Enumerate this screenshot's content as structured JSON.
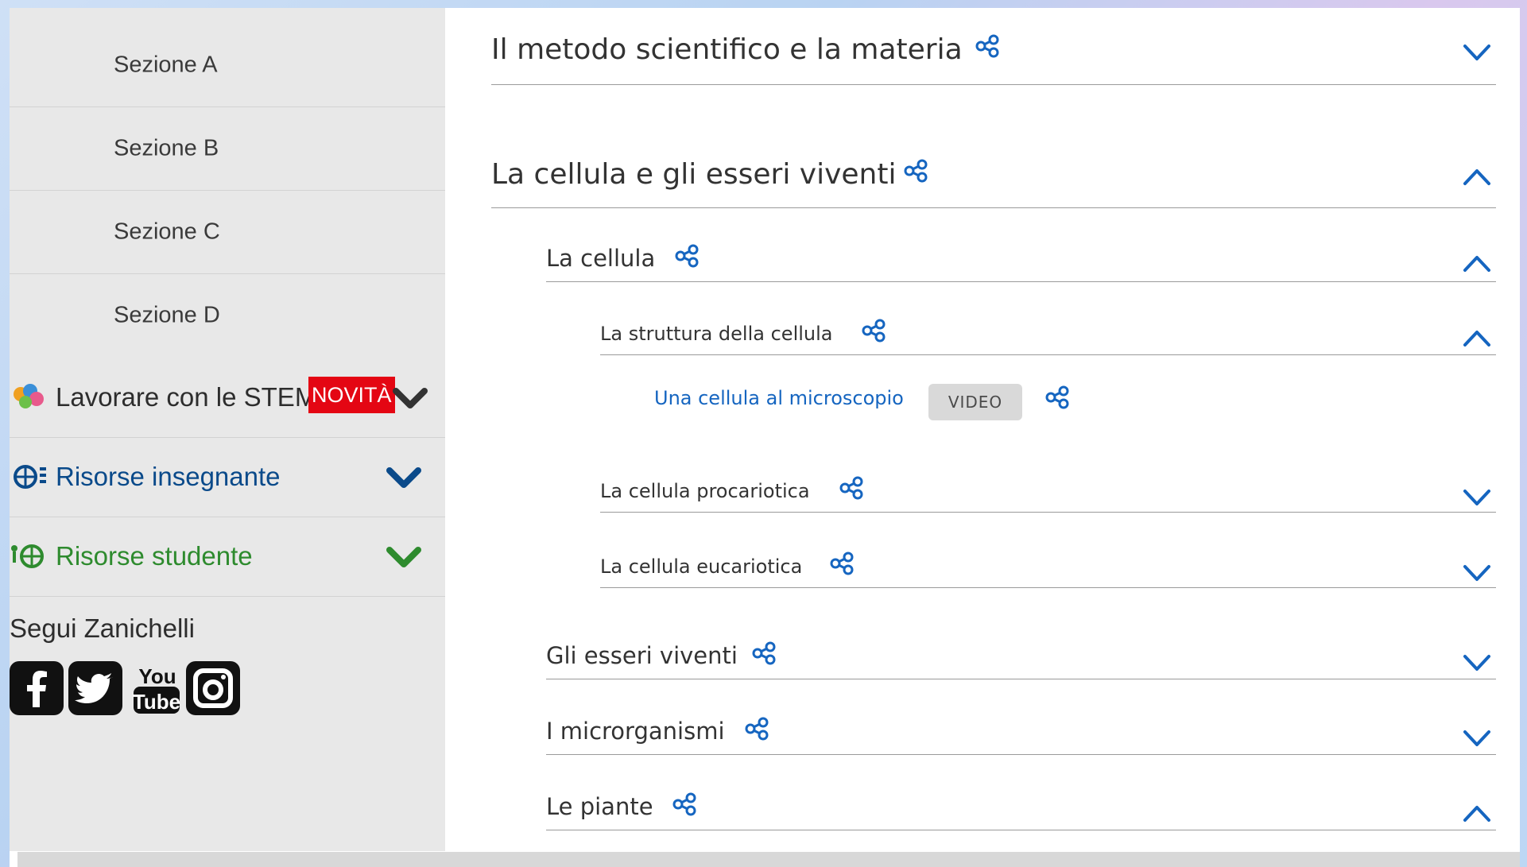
{
  "sidebar": {
    "sections": [
      {
        "label": "Sezione A"
      },
      {
        "label": "Sezione B"
      },
      {
        "label": "Sezione C"
      },
      {
        "label": "Sezione D"
      }
    ],
    "resources": [
      {
        "label": "Lavorare con le STEM",
        "badge": "NOVITÀ",
        "color": "#2d2d2d",
        "icon": "stem-icon",
        "chevron": "chevron-down-icon"
      },
      {
        "label": "Risorse insegnante",
        "color": "#0a4a8a",
        "icon": "teacher-resources-icon",
        "chevron": "chevron-down-icon"
      },
      {
        "label": "Risorse studente",
        "color": "#2e8b2e",
        "icon": "student-resources-icon",
        "chevron": "chevron-down-icon"
      }
    ],
    "follow": {
      "title": "Segui Zanichelli",
      "social": [
        "facebook-icon",
        "twitter-icon",
        "youtube-icon",
        "instagram-icon"
      ]
    }
  },
  "content": {
    "rows": [
      {
        "title": "Il metodo scientifico e la materia",
        "expanded": false
      },
      {
        "title": "La cellula e gli esseri viventi",
        "expanded": true
      },
      {
        "title": "La cellula",
        "expanded": true
      },
      {
        "title": "La struttura della cellula",
        "expanded": true
      },
      {
        "title": "La cellula procariotica",
        "expanded": false
      },
      {
        "title": "La cellula eucariotica",
        "expanded": false
      },
      {
        "title": "Gli esseri viventi",
        "expanded": false
      },
      {
        "title": "I microrganismi",
        "expanded": false
      },
      {
        "title": "Le piante",
        "expanded": true
      }
    ],
    "resource_item": {
      "title": "Una cellula al microscopio",
      "tag": "VIDEO"
    }
  },
  "colors": {
    "accent": "#1565c0",
    "badge": "#e40613",
    "sidebar_bg": "#e8e8e8"
  }
}
